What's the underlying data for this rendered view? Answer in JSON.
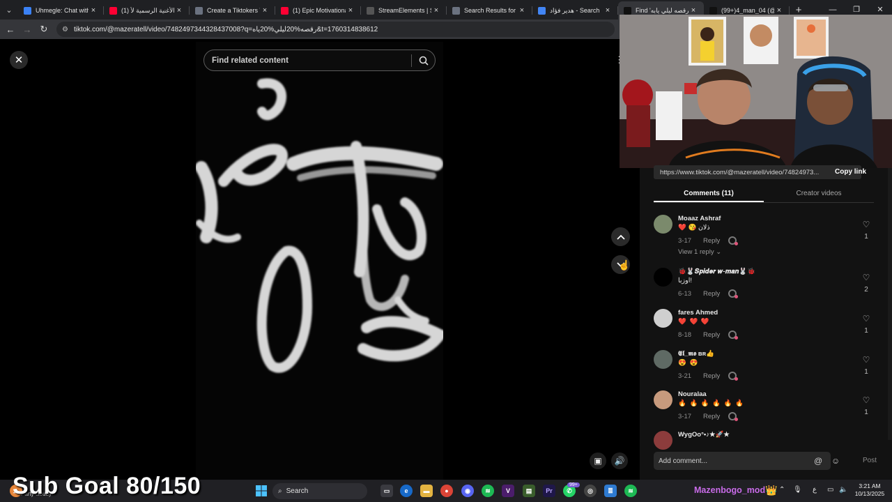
{
  "browser": {
    "tabs": [
      {
        "title": "Uhmegle: Chat with S",
        "icon": "uhmegle-icon",
        "color": "#3b82f6"
      },
      {
        "title": "(1) الأغنية الرسمية لأ",
        "icon": "youtube-icon",
        "color": "#ff0033"
      },
      {
        "title": "Create a Tiktokers Tie",
        "icon": "document-icon",
        "color": "#6b7280"
      },
      {
        "title": "(1) Epic Motivational",
        "icon": "youtube-icon",
        "color": "#ff0033"
      },
      {
        "title": "StreamElements | Sub",
        "icon": "streamelements-icon",
        "color": "#555"
      },
      {
        "title": "Search Results for 'c",
        "icon": "document-icon",
        "color": "#6b7280"
      },
      {
        "title": "هدير فؤاد - Search",
        "icon": "google-icon",
        "color": "#4285f4"
      },
      {
        "title": "Find 'رقصه ليلي يابه'",
        "icon": "tiktok-icon",
        "color": "#111"
      },
      {
        "title": "(99+)4_man_04 (@4",
        "icon": "tiktok-icon",
        "color": "#111"
      }
    ],
    "active_tab_index": 7,
    "url": "tiktok.com/@mazeratell/video/7482497344328437008?q=رقصه%20ليلي%20ياه&t=1760314838612"
  },
  "video": {
    "search_placeholder": "Find related content"
  },
  "panel": {
    "share_link": "https://www.tiktok.com/@mazeratell/video/74824973...",
    "copy_link_label": "Copy link",
    "tabs": [
      {
        "label": "Comments (11)",
        "active": true
      },
      {
        "label": "Creator videos",
        "active": false
      }
    ],
    "comments": [
      {
        "name": "Moaaz Ashraf",
        "text": "❤️ 😘 ذلان",
        "date": "3-17",
        "reply": "Reply",
        "likes": "1",
        "view_replies": "View 1 reply",
        "avatar_color": "#7b8a6c"
      },
      {
        "name": "🐞🐰𝑺𝒑𝒊𝒅𝒆𝒓 𝒘-𝒎𝒂𝒏🐰🐞",
        "text": "اوزبا!",
        "date": "6-13",
        "reply": "Reply",
        "likes": "2",
        "avatar_color": "#000000"
      },
      {
        "name": "fares Ahmed",
        "text": "❤️ ❤️ ❤️",
        "date": "8-18",
        "reply": "Reply",
        "likes": "1",
        "avatar_color": "#cfcfcf"
      },
      {
        "name": "𝕰𝖑_𝖒𝖔 ʙʀ👍",
        "text": "😍 😍",
        "date": "3-21",
        "reply": "Reply",
        "likes": "1",
        "avatar_color": "#5f6a64"
      },
      {
        "name": "Nouralaa",
        "text": "🔥 🔥 🔥 🔥 🔥 🔥",
        "date": "3-17",
        "reply": "Reply",
        "likes": "1",
        "avatar_color": "#c79a7d"
      },
      {
        "name": "WygOo°•♪★🚀★",
        "text": "",
        "date": "",
        "reply": "",
        "likes": "",
        "avatar_color": "#8c3c3c"
      }
    ],
    "add_comment_placeholder": "Add comment...",
    "post_label": "Post"
  },
  "overlay": {
    "sub_goal": "Sub Goal 80/150",
    "widget_text": "Party cloudy",
    "moderator": "Mazenbogo_mod"
  },
  "taskbar": {
    "search_label": "Search",
    "badge": "99+",
    "lang": "ع",
    "time": "3:21 AM",
    "date": "10/13/2025"
  }
}
